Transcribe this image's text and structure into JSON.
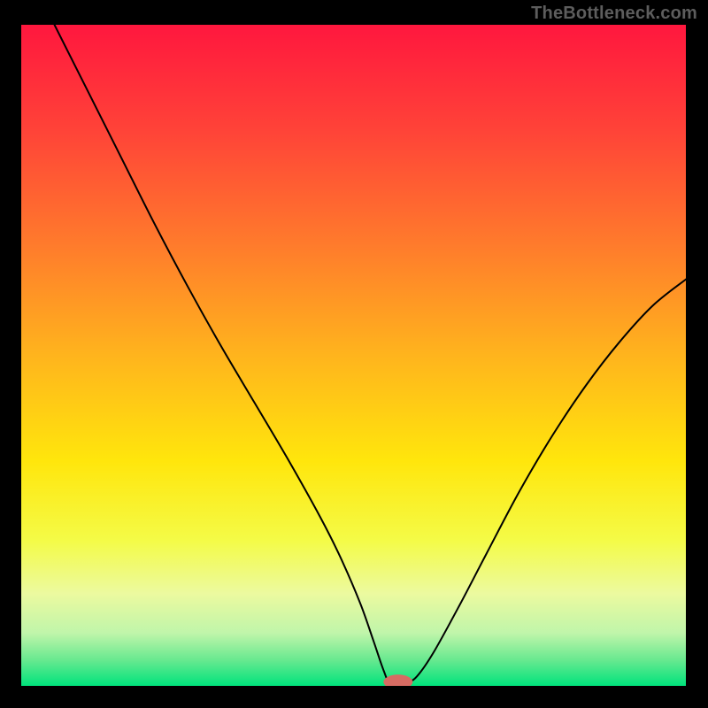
{
  "watermark": {
    "text": "TheBottleneck.com"
  },
  "chart_data": {
    "type": "line",
    "title": "",
    "xlabel": "",
    "ylabel": "",
    "xlim": [
      0,
      100
    ],
    "ylim": [
      0,
      100
    ],
    "background_gradient": {
      "stops": [
        {
          "offset": 0.0,
          "color": "#ff173e"
        },
        {
          "offset": 0.16,
          "color": "#ff4338"
        },
        {
          "offset": 0.33,
          "color": "#ff7a2c"
        },
        {
          "offset": 0.5,
          "color": "#ffb41d"
        },
        {
          "offset": 0.66,
          "color": "#ffe60c"
        },
        {
          "offset": 0.78,
          "color": "#f4fb47"
        },
        {
          "offset": 0.86,
          "color": "#ecfa9f"
        },
        {
          "offset": 0.92,
          "color": "#c0f5aa"
        },
        {
          "offset": 0.96,
          "color": "#6ae990"
        },
        {
          "offset": 1.0,
          "color": "#00e37c"
        }
      ]
    },
    "series": [
      {
        "name": "bottleneck-curve",
        "color": "#000000",
        "stroke_width": 2,
        "points": [
          {
            "x": 5.0,
            "y": 100.0
          },
          {
            "x": 10.0,
            "y": 90.0
          },
          {
            "x": 15.0,
            "y": 80.0
          },
          {
            "x": 20.0,
            "y": 70.0
          },
          {
            "x": 25.0,
            "y": 60.5
          },
          {
            "x": 30.0,
            "y": 51.5
          },
          {
            "x": 35.0,
            "y": 43.0
          },
          {
            "x": 40.0,
            "y": 34.5
          },
          {
            "x": 45.0,
            "y": 25.5
          },
          {
            "x": 48.0,
            "y": 19.5
          },
          {
            "x": 51.0,
            "y": 12.5
          },
          {
            "x": 53.0,
            "y": 6.8
          },
          {
            "x": 54.5,
            "y": 2.4
          },
          {
            "x": 55.5,
            "y": 0.6
          },
          {
            "x": 58.0,
            "y": 0.6
          },
          {
            "x": 59.5,
            "y": 1.4
          },
          {
            "x": 62.0,
            "y": 5.0
          },
          {
            "x": 66.0,
            "y": 12.3
          },
          {
            "x": 70.0,
            "y": 20.0
          },
          {
            "x": 75.0,
            "y": 29.5
          },
          {
            "x": 80.0,
            "y": 38.0
          },
          {
            "x": 85.0,
            "y": 45.5
          },
          {
            "x": 90.0,
            "y": 52.0
          },
          {
            "x": 95.0,
            "y": 57.5
          },
          {
            "x": 100.0,
            "y": 61.5
          }
        ]
      }
    ],
    "marker": {
      "name": "bottleneck-marker",
      "x": 56.7,
      "y": 0.6,
      "rx": 2.2,
      "ry": 1.1,
      "color": "#d66b63"
    }
  },
  "colors": {
    "page_bg": "#000000",
    "watermark_color": "#5d5d5d"
  }
}
